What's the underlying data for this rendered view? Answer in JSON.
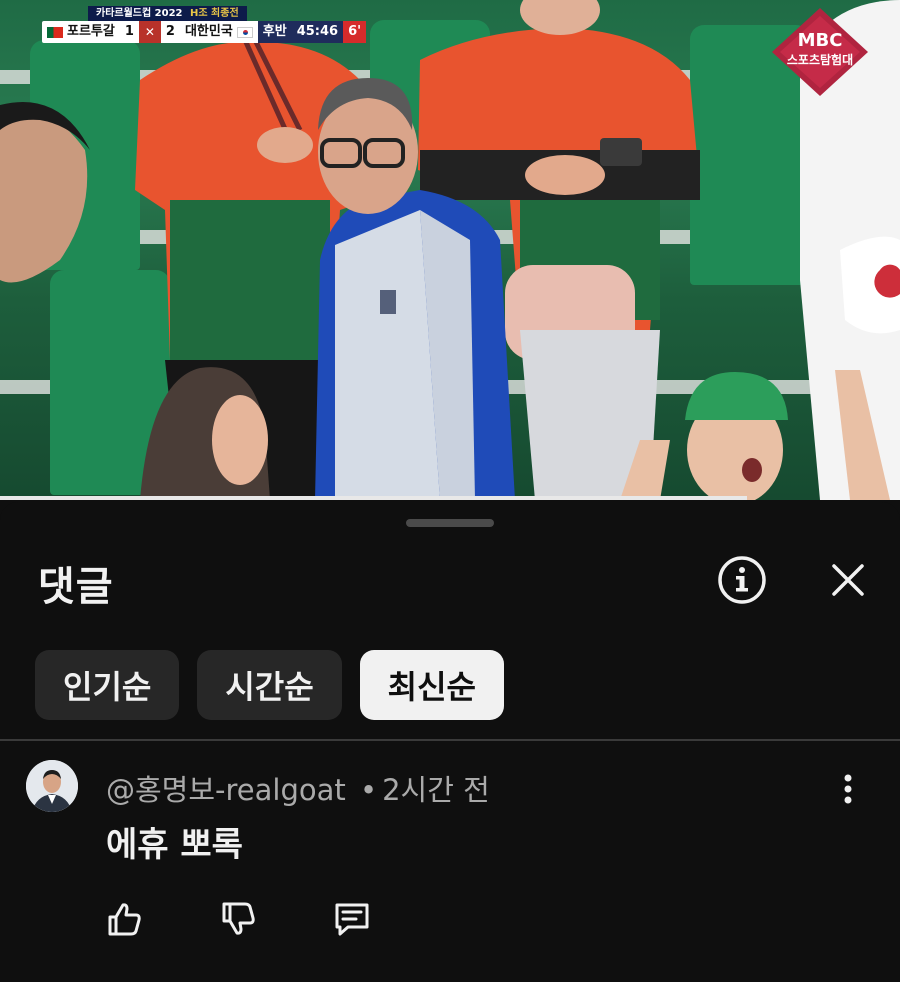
{
  "video": {
    "scoreboard": {
      "competition": "카타르월드컵 2022",
      "group": "H조 최종전",
      "home_team": "포르투갈",
      "home_score": "1",
      "away_score": "2",
      "away_team": "대한민국",
      "period": "후반",
      "clock": "45:46",
      "added_time": "6'"
    },
    "broadcaster": {
      "logo_text": "MBC",
      "channel_text": "스포츠탐험대"
    },
    "progress_fraction": 0.83
  },
  "comments_panel": {
    "title": "댓글",
    "info_icon": "info-icon",
    "close_icon": "close-icon",
    "sort_chips": [
      {
        "label": "인기순",
        "active": false
      },
      {
        "label": "시간순",
        "active": false
      },
      {
        "label": "최신순",
        "active": true
      }
    ],
    "comments": [
      {
        "author": "@홍명보-realgoat",
        "separator": "•",
        "time": "2시간 전",
        "text": "에휴 뽀록",
        "like_icon": "thumbs-up-icon",
        "dislike_icon": "thumbs-down-icon",
        "reply_icon": "reply-icon",
        "more_icon": "more-vert-icon"
      }
    ]
  },
  "colors": {
    "background": "#0f0f0f",
    "chip": "#272727",
    "chip_active": "#f1f1f1",
    "meta_text": "#aaaaaa",
    "text": "#f1f1f1"
  }
}
